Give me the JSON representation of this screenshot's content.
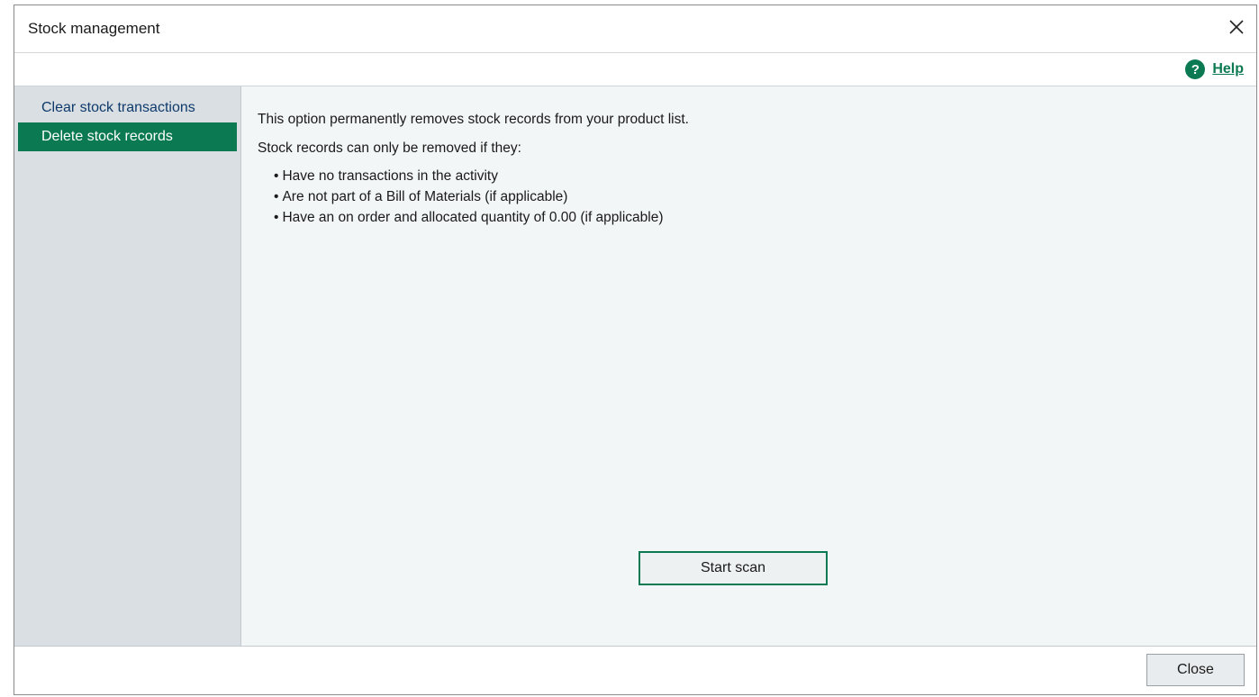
{
  "window": {
    "title": "Stock management",
    "close_icon": "close-icon"
  },
  "helpbar": {
    "help_icon": "question-circle-icon",
    "help_label": "Help"
  },
  "sidebar": {
    "items": [
      {
        "label": "Clear stock transactions",
        "active": false
      },
      {
        "label": "Delete stock records",
        "active": true
      }
    ]
  },
  "content": {
    "intro": "This option permanently removes stock records from your product list.",
    "conditions_heading": "Stock records can only be removed if they:",
    "conditions": [
      "Have no transactions in the activity",
      "Are not part of a Bill of Materials (if applicable)",
      "Have an on order and allocated quantity of 0.00 (if applicable)"
    ],
    "start_scan_label": "Start scan"
  },
  "footer": {
    "close_label": "Close"
  },
  "colors": {
    "accent": "#0b7a53",
    "sidebar_bg": "#d9dfe2",
    "content_bg": "#f3f6f6",
    "nav_text": "#0e3a6c"
  }
}
